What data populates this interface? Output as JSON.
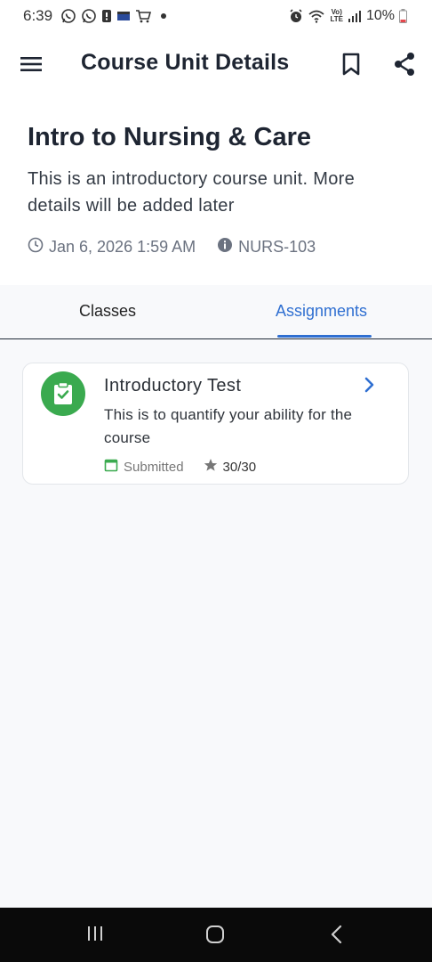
{
  "status_bar": {
    "time": "6:39",
    "battery": "10%",
    "icons": [
      "whatsapp-icon",
      "whatsapp-icon",
      "notification-icon",
      "email-icon",
      "cart-icon",
      "dot-icon",
      "alarm-icon",
      "wifi-icon",
      "volte-icon",
      "signal-icon",
      "battery-icon"
    ],
    "volte_label_top": "Vo)",
    "volte_label_bottom": "LTE"
  },
  "app_bar": {
    "title": "Course Unit Details",
    "icons": [
      "menu-icon",
      "bookmark-icon",
      "share-icon"
    ]
  },
  "course": {
    "title": "Intro to Nursing & Care",
    "description": "This is an introductory course unit. More details will be added later",
    "date": "Jan 6, 2026 1:59 AM",
    "code": "NURS-103"
  },
  "tabs": {
    "classes": "Classes",
    "assignments": "Assignments",
    "active": "assignments"
  },
  "assignments": [
    {
      "title": "Introductory Test",
      "description": "This is to quantify your ability for the course",
      "status": "Submitted",
      "score": "30/30"
    }
  ],
  "colors": {
    "accent": "#2f6fd1",
    "badge_green": "#3aaa4f",
    "title_text": "#1e2532",
    "background": "#f8f9fb"
  },
  "nav_bar": {
    "icons": [
      "recent-apps-icon",
      "home-icon",
      "back-icon"
    ]
  }
}
